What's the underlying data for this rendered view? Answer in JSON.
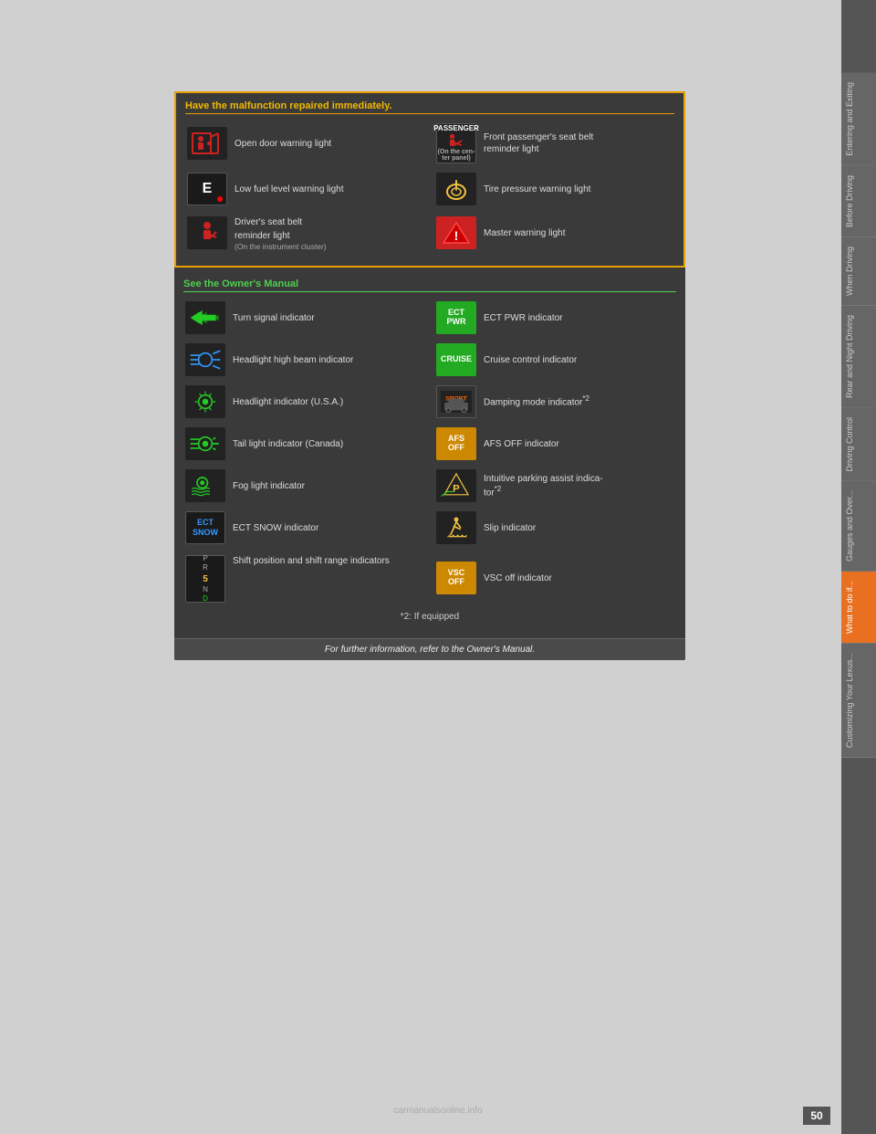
{
  "page": {
    "number": "50",
    "watermark": "carmanualsonline.info"
  },
  "sidebar": {
    "tabs": [
      {
        "label": "Entering and Exiting",
        "active": false
      },
      {
        "label": "Before Driving",
        "active": false
      },
      {
        "label": "When Driving",
        "active": false
      },
      {
        "label": "Rear and Night Driving",
        "active": false
      },
      {
        "label": "Driving Control",
        "active": false
      },
      {
        "label": "Gauges and Over...",
        "active": false
      },
      {
        "label": "What to do if...",
        "active": true
      },
      {
        "label": "Customizing Your Lexus...",
        "active": false
      }
    ]
  },
  "warning_section": {
    "title": "Have the malfunction repaired immediately.",
    "items": [
      {
        "label": "Open door warning light",
        "icon_type": "svg_door"
      },
      {
        "label": "Front passenger's seat belt reminder light",
        "icon_type": "passenger",
        "note": "(On the center panel)"
      },
      {
        "label": "Low fuel level warning light",
        "icon_type": "e_box"
      },
      {
        "label": "Tire pressure warning light",
        "icon_type": "svg_tire"
      },
      {
        "label": "Driver's seat belt reminder light",
        "icon_type": "svg_seatbelt",
        "note": "(On the instrument cluster)"
      },
      {
        "label": "Master warning light",
        "icon_type": "svg_master"
      }
    ]
  },
  "manual_section": {
    "title": "See the Owner's Manual",
    "items_left": [
      {
        "label": "Turn signal indicator",
        "icon_type": "svg_turn"
      },
      {
        "label": "Headlight high beam indicator",
        "icon_type": "svg_highbeam"
      },
      {
        "label": "Headlight indicator (U.S.A.)",
        "icon_type": "svg_headlight"
      },
      {
        "label": "Tail light indicator (Canada)",
        "icon_type": "svg_taillight"
      },
      {
        "label": "Fog light indicator",
        "icon_type": "svg_fog"
      },
      {
        "label": "ECT SNOW indicator",
        "icon_type": "ect_snow"
      },
      {
        "label": "Shift position and shift range indicators",
        "icon_type": "shift"
      }
    ],
    "items_right": [
      {
        "label": "ECT PWR indicator",
        "icon_type": "ect_pwr"
      },
      {
        "label": "Cruise control indicator",
        "icon_type": "cruise"
      },
      {
        "label": "Damping mode indicator *2",
        "icon_type": "sport"
      },
      {
        "label": "AFS OFF indicator",
        "icon_type": "afs"
      },
      {
        "label": "Intuitive parking assist indicator *2",
        "icon_type": "svg_parking"
      },
      {
        "label": "Slip indicator",
        "icon_type": "svg_slip"
      },
      {
        "label": "VSC off indicator",
        "icon_type": "vsc"
      }
    ]
  },
  "footnote": "*2: If equipped",
  "bottom_bar": "For further information, refer to the Owner's Manual."
}
